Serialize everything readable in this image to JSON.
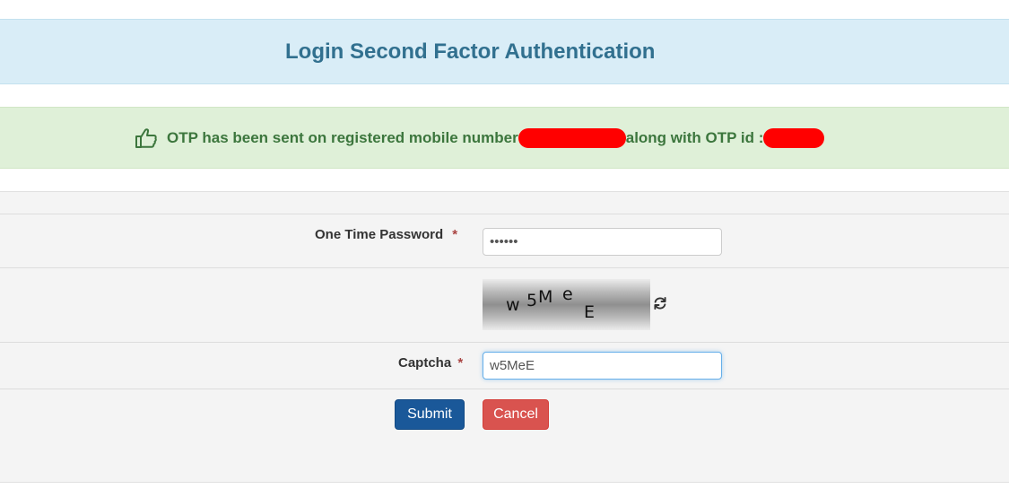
{
  "header": {
    "title": "Login Second Factor Authentication"
  },
  "alert": {
    "icon": "thumbs-up-icon",
    "text_before": "OTP has been sent on registered mobile number",
    "text_middle": "along with OTP id :",
    "redaction_color": "#ff0000"
  },
  "form": {
    "otp": {
      "label": "One Time Password",
      "required_mark": "*",
      "value": "••••••"
    },
    "captcha_image": {
      "chars": [
        "w",
        "5",
        "M",
        "e",
        "E"
      ],
      "refresh_icon": "refresh-icon"
    },
    "captcha": {
      "label": "Captcha",
      "required_mark": "*",
      "value": "w5MeE"
    },
    "buttons": {
      "submit": "Submit",
      "cancel": "Cancel"
    }
  },
  "colors": {
    "title_bg": "#d9edf7",
    "title_text": "#31708f",
    "alert_bg": "#dff0d8",
    "alert_text": "#3c763d",
    "submit_bg": "#1a5899",
    "cancel_bg": "#d9534f",
    "required": "#a94442"
  }
}
